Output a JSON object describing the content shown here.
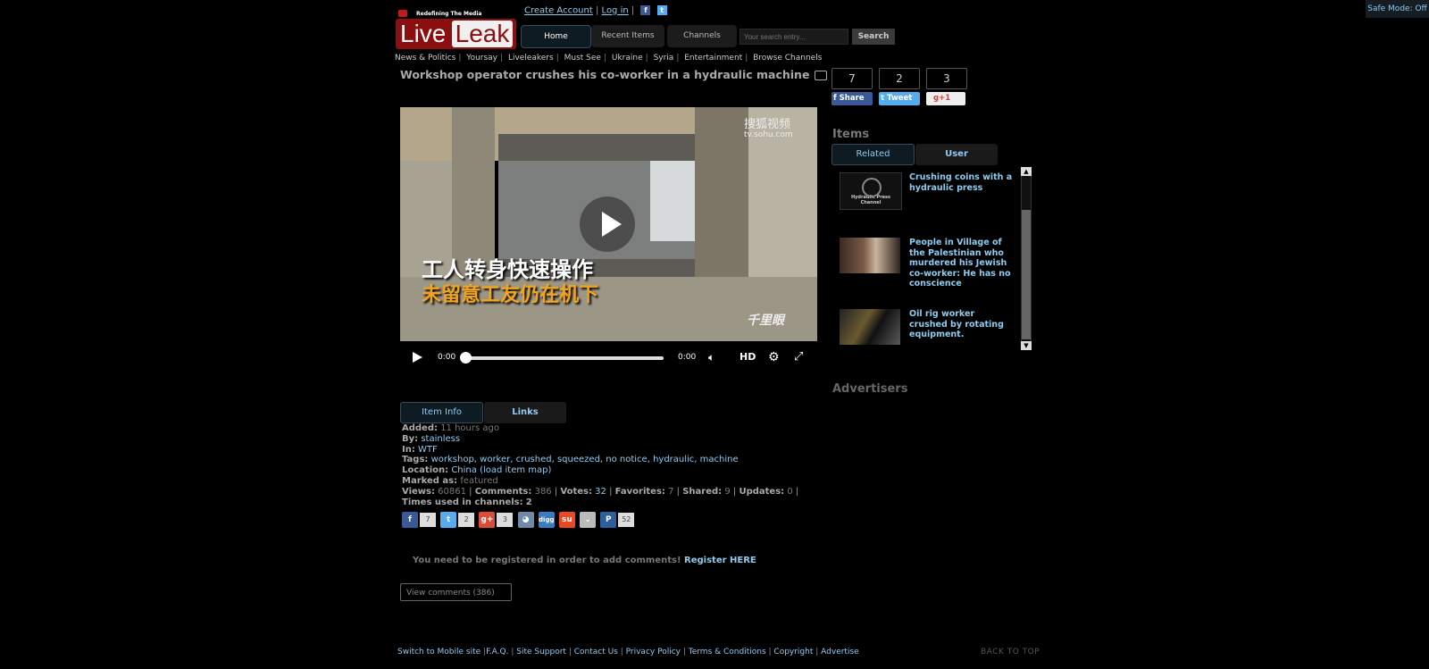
{
  "safe_mode": "Safe Mode: Off",
  "logo": {
    "tagline": "Redefining The Media",
    "live": "Live",
    "leak": "Leak"
  },
  "top_links": {
    "create_account": "Create Account",
    "log_in": "Log in",
    "sep": "|"
  },
  "nav": {
    "home": "Home",
    "recent": "Recent Items",
    "channels": "Channels"
  },
  "search": {
    "placeholder": "Your search entry...",
    "button": "Search"
  },
  "categories": [
    "News & Politics",
    "Yoursay",
    "Liveleakers",
    "Must See",
    "Ukraine",
    "Syria",
    "Entertainment",
    "Browse Channels"
  ],
  "title": "Workshop operator crushes his co-worker in a hydraulic machine",
  "video": {
    "watermark_top": "搜狐视频",
    "watermark_url": "tv.sohu.com",
    "watermark_bottom": "千里眼",
    "subtitle_line1": "工人转身快速操作",
    "subtitle_line2": "未留意工友仍在机下",
    "time_current": "0:00",
    "time_total": "0:00",
    "hd": "HD"
  },
  "info_tabs": {
    "item_info": "Item Info",
    "links": "Links"
  },
  "info": {
    "added_label": "Added:",
    "added": "11 hours ago",
    "by_label": "By:",
    "by": "stainless",
    "in_label": "In:",
    "in": "WTF",
    "tags_label": "Tags:",
    "tags": "workshop, worker, crushed, squeezed, no notice, hydraulic, machine",
    "location_label": "Location:",
    "location": "China",
    "location_map": "(load item map)",
    "marked_label": "Marked as:",
    "marked": "featured",
    "views_label": "Views:",
    "views": "60861",
    "comments_label": "Comments:",
    "comments": "386",
    "votes_label": "Votes:",
    "votes": "32",
    "favorites_label": "Favorites:",
    "favorites": "7",
    "shared_label": "Shared:",
    "shared": "9",
    "updates_label": "Updates:",
    "updates": "0",
    "channels_label": "Times used in channels:",
    "channels": "2"
  },
  "share_counts": {
    "facebook": "7",
    "twitter": "2",
    "gplus": "3",
    "pocket": "52"
  },
  "register": {
    "text": "You need to be registered in order to add comments!",
    "link": "Register HERE"
  },
  "view_comments": "View comments (386)",
  "right": {
    "counts": {
      "facebook": "7",
      "twitter": "2",
      "gplus": "3"
    },
    "share_fb": "Share",
    "share_tw": "Tweet",
    "share_gp": "+1",
    "items_heading": "Items",
    "tab_related": "Related",
    "tab_user": "User",
    "related": [
      {
        "title": "Crushing coins with a hydraulic press",
        "thumb_text": "Hydraulic Press Channel"
      },
      {
        "title": "People in Village of the Palestinian who murdered his Jewish co-worker: He has no conscience"
      },
      {
        "title": "Oil rig worker crushed by rotating equipment."
      }
    ],
    "advertisers": "Advertisers"
  },
  "footer": {
    "mobile": "Switch to Mobile site",
    "faq": "F.A.Q.",
    "support": "Site Support",
    "contact": "Contact Us",
    "privacy": "Privacy Policy",
    "terms": "Terms & Conditions",
    "copyright": "Copyright",
    "advertise": "Advertise",
    "back_to_top": "BACK TO TOP"
  },
  "colors": {
    "background": "#000000",
    "link": "#8ecbf0",
    "brand_red": "#8b0f10"
  }
}
